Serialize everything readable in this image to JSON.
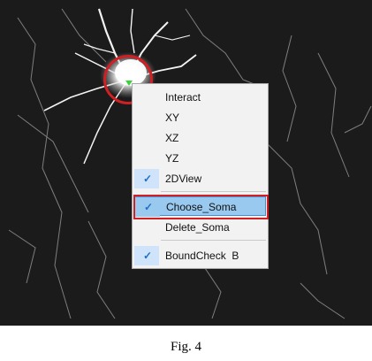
{
  "menu": {
    "items": [
      {
        "label": "Interact",
        "checked": false
      },
      {
        "label": "XY",
        "checked": false
      },
      {
        "label": "XZ",
        "checked": false
      },
      {
        "label": "YZ",
        "checked": false
      },
      {
        "label": "2DView",
        "checked": true
      },
      {
        "label": "Choose_Soma",
        "checked": true,
        "highlighted": true
      },
      {
        "label": "Delete_Soma",
        "checked": false
      },
      {
        "label": "BoundCheck  B",
        "checked": true
      }
    ],
    "check_glyph": "✓"
  },
  "caption": "Fig. 4",
  "colors": {
    "highlight_fill": "#99c9ef",
    "annotation_red": "#d11f24",
    "soma_marker": "#39d43a",
    "check_color": "#1f6fc5"
  }
}
